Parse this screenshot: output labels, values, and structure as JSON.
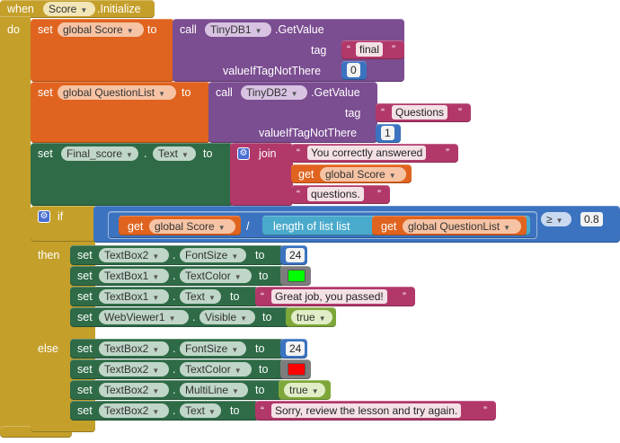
{
  "event": {
    "when": "when",
    "component": "Score",
    "event_name": ".Initialize",
    "do": "do"
  },
  "kw": {
    "set": "set",
    "to": "to",
    "call": "call",
    "get": "get",
    "join": "join",
    "if": "if",
    "then": "then",
    "else": "else",
    "dot": ".",
    "div": "/"
  },
  "rows": {
    "r1": {
      "var": "global Score",
      "comp": "TinyDB1",
      "method": ".GetValue",
      "tag_label": "tag",
      "tag_value": "final",
      "default_label": "valueIfTagNotThere",
      "default_value": "0"
    },
    "r2": {
      "var": "global QuestionList",
      "comp": "TinyDB2",
      "method": ".GetValue",
      "tag_label": "tag",
      "tag_value": "Questions",
      "default_label": "valueIfTagNotThere",
      "default_value": "1"
    },
    "r3": {
      "comp": "Final_score",
      "prop": "Text",
      "str1": "You correctly answered",
      "var": "global Score",
      "str2": "questions."
    },
    "if": {
      "var1": "global Score",
      "length_label": "length of list  list",
      "var2": "global QuestionList",
      "op": "≥",
      "threshold": "0.8"
    },
    "then": [
      {
        "comp": "TextBox2",
        "prop": "FontSize",
        "value": "24"
      },
      {
        "comp": "TextBox1",
        "prop": "TextColor",
        "color": "#00ff00"
      },
      {
        "comp": "TextBox1",
        "prop": "Text",
        "value": "Great job, you passed!"
      },
      {
        "comp": "WebViewer1",
        "prop": "Visible",
        "value": "true"
      }
    ],
    "else": [
      {
        "comp": "TextBox2",
        "prop": "FontSize",
        "value": "24"
      },
      {
        "comp": "TextBox2",
        "prop": "TextColor",
        "color": "#ff0000"
      },
      {
        "comp": "TextBox2",
        "prop": "MultiLine",
        "value": "true"
      },
      {
        "comp": "TextBox2",
        "prop": "Text",
        "value": "Sorry, review the lesson and try again."
      }
    ]
  },
  "colors": {
    "event": "#c4a02b",
    "variable": "#e0641f",
    "component_call": "#7b4d91",
    "text": "#b2386a",
    "math": "#3b73c0",
    "logic_bool": "#7ea73a",
    "control": "#c4a02b",
    "component_set": "#2e6b46",
    "lists": "#4aaacc"
  }
}
